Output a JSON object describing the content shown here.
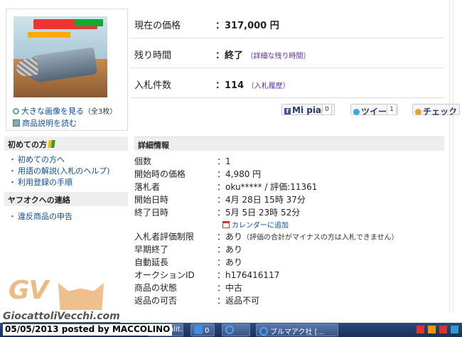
{
  "gallery": {
    "zoom_link": "大きな画像を見る",
    "zoom_count": "（全3枚）",
    "manual_link": "商品説明を読む"
  },
  "sidebar": {
    "beginner_heading": "初めての方",
    "beginner_links": [
      "初めての方へ",
      "用語の解説(入札のヘルプ)",
      "利用登録の手順"
    ],
    "contact_heading": "ヤフオクへの連絡",
    "contact_links": [
      "違反商品の申告"
    ]
  },
  "summary": {
    "price_label": "現在の価格",
    "price_value": "317,000 円",
    "time_label": "残り時間",
    "time_value": "終了",
    "time_detail": "（詳細な残り時間）",
    "bids_label": "入札件数",
    "bids_value": "114",
    "bids_history": "（入札履歴）"
  },
  "social": {
    "facebook_label": "Mi piace",
    "facebook_count": "0",
    "tweet_label": "ツイート",
    "tweet_count": "1",
    "check_label": "チェック"
  },
  "details": {
    "heading": "詳細情報",
    "rows": [
      {
        "key": "個数",
        "value": "1"
      },
      {
        "key": "開始時の価格",
        "value": "4,980 円"
      },
      {
        "key": "落札者",
        "value": "oku***** / 評価:11361"
      },
      {
        "key": "開始日時",
        "value": "4月 28日 15時 37分"
      },
      {
        "key": "終了日時",
        "value": "5月 5日 23時 52分"
      },
      {
        "key": "入札者評価制限",
        "value": "あり",
        "note": "（評価の合計がマイナスの方は入札できません）"
      },
      {
        "key": "早期終了",
        "value": "あり"
      },
      {
        "key": "自動延長",
        "value": "あり"
      },
      {
        "key": "オークションID",
        "value": "h176416117"
      },
      {
        "key": "商品の状態",
        "value": "中古"
      },
      {
        "key": "返品の可否",
        "value": "返品不可"
      }
    ],
    "calendar_link": "カレンダーに追加",
    "separator": "："
  },
  "watermark": {
    "logo": "GV",
    "site": "GiocattoliVecchi.com",
    "caption": "05/05/2013 posted by MACCOLINO"
  },
  "taskbar": {
    "items": [
      "(Modalit...",
      "0",
      "",
      "ブルマアク社 [..."
    ]
  },
  "colors": {
    "link": "#0b4fa0",
    "purple_link": "#5a2ca0",
    "header_bg": "#eeeeee",
    "taskbar": "#1b2f55"
  }
}
